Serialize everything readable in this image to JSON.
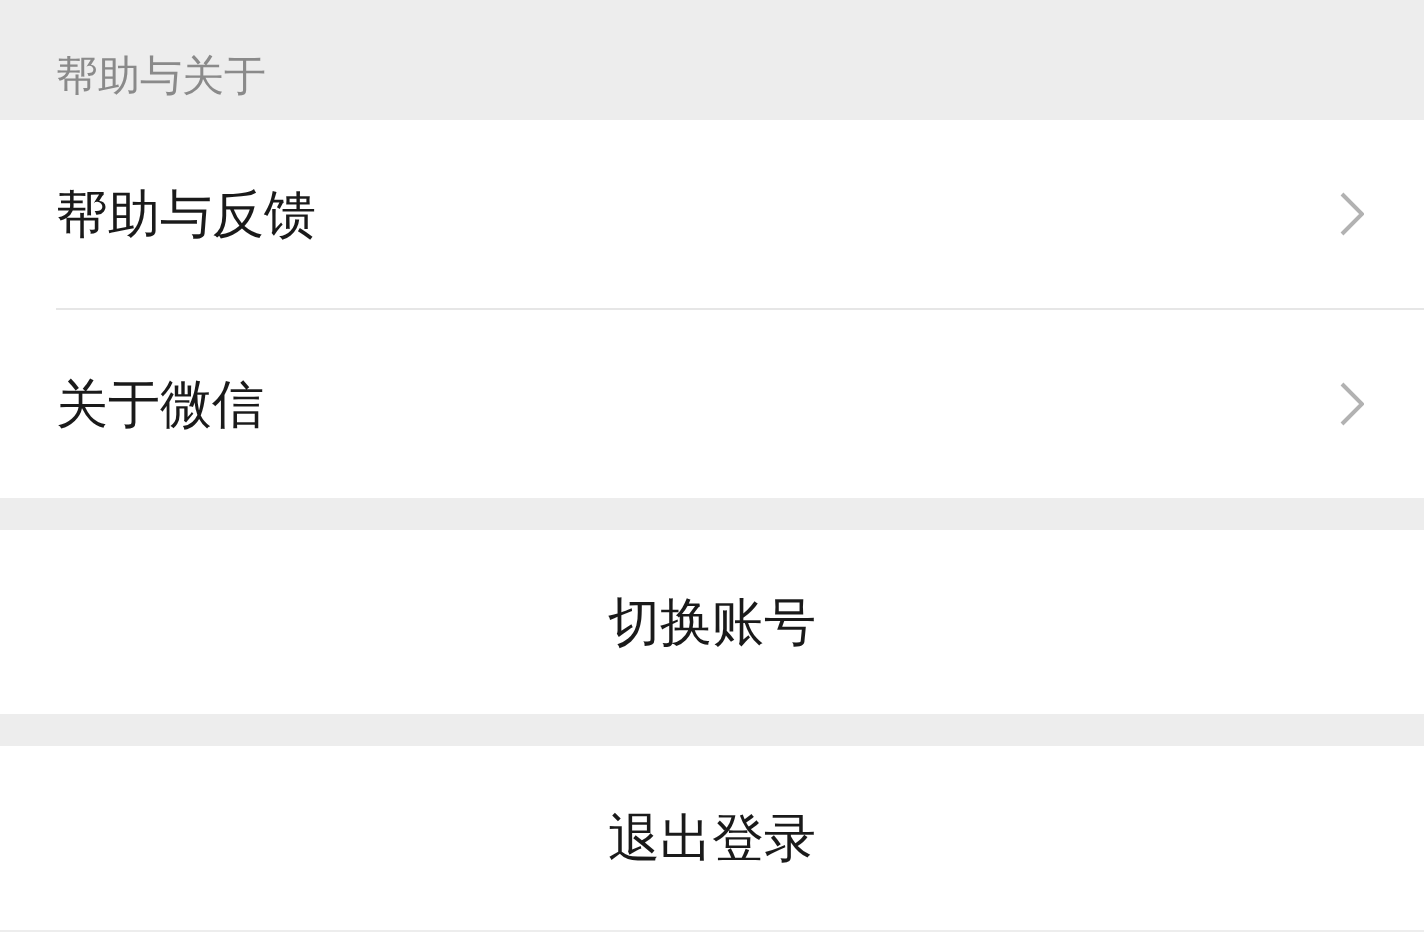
{
  "section_title": "帮助与关于",
  "items": [
    {
      "label": "帮助与反馈"
    },
    {
      "label": "关于微信"
    }
  ],
  "actions": [
    {
      "label": "切换账号"
    },
    {
      "label": "退出登录"
    }
  ]
}
